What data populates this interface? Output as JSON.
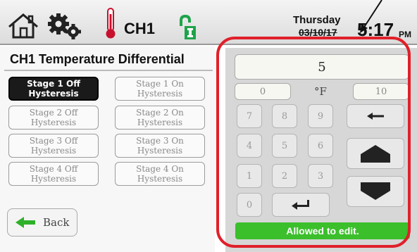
{
  "header": {
    "channel": "CH1",
    "day": "Thursday",
    "date": "03/10/17",
    "time": "5:17",
    "ampm": "PM"
  },
  "panel": {
    "title": "CH1 Temperature Differential",
    "buttons": [
      {
        "label": "Stage 1 Off\nHysteresis",
        "active": true
      },
      {
        "label": "Stage 1 On\nHysteresis",
        "active": false
      },
      {
        "label": "Stage 2 Off\nHysteresis",
        "active": false
      },
      {
        "label": "Stage 2 On\nHysteresis",
        "active": false
      },
      {
        "label": "Stage 3 Off\nHysteresis",
        "active": false
      },
      {
        "label": "Stage 3 On\nHysteresis",
        "active": false
      },
      {
        "label": "Stage 4 Off\nHysteresis",
        "active": false
      },
      {
        "label": "Stage 4 On\nHysteresis",
        "active": false
      }
    ],
    "back_label": "Back"
  },
  "keypad": {
    "value": "5",
    "min": "0",
    "max": "10",
    "unit": "°F",
    "keys": [
      "7",
      "8",
      "9",
      "4",
      "5",
      "6",
      "1",
      "2",
      "3",
      "0"
    ],
    "status": "Allowed to edit."
  },
  "colors": {
    "active_button": "#1a1a1a",
    "status_green": "#3bbf2b",
    "highlight_red": "#e0202a",
    "lock_green": "#1fa34a",
    "thermometer_red": "#c8102e"
  },
  "icons": {
    "home": "home-icon",
    "settings": "gear-icon",
    "thermometer": "thermometer-icon",
    "lock": "lock-open-icon",
    "back": "arrow-left-icon",
    "backspace": "arrow-left-icon",
    "enter": "enter-icon",
    "up": "triangle-up-icon",
    "down": "triangle-down-icon"
  }
}
